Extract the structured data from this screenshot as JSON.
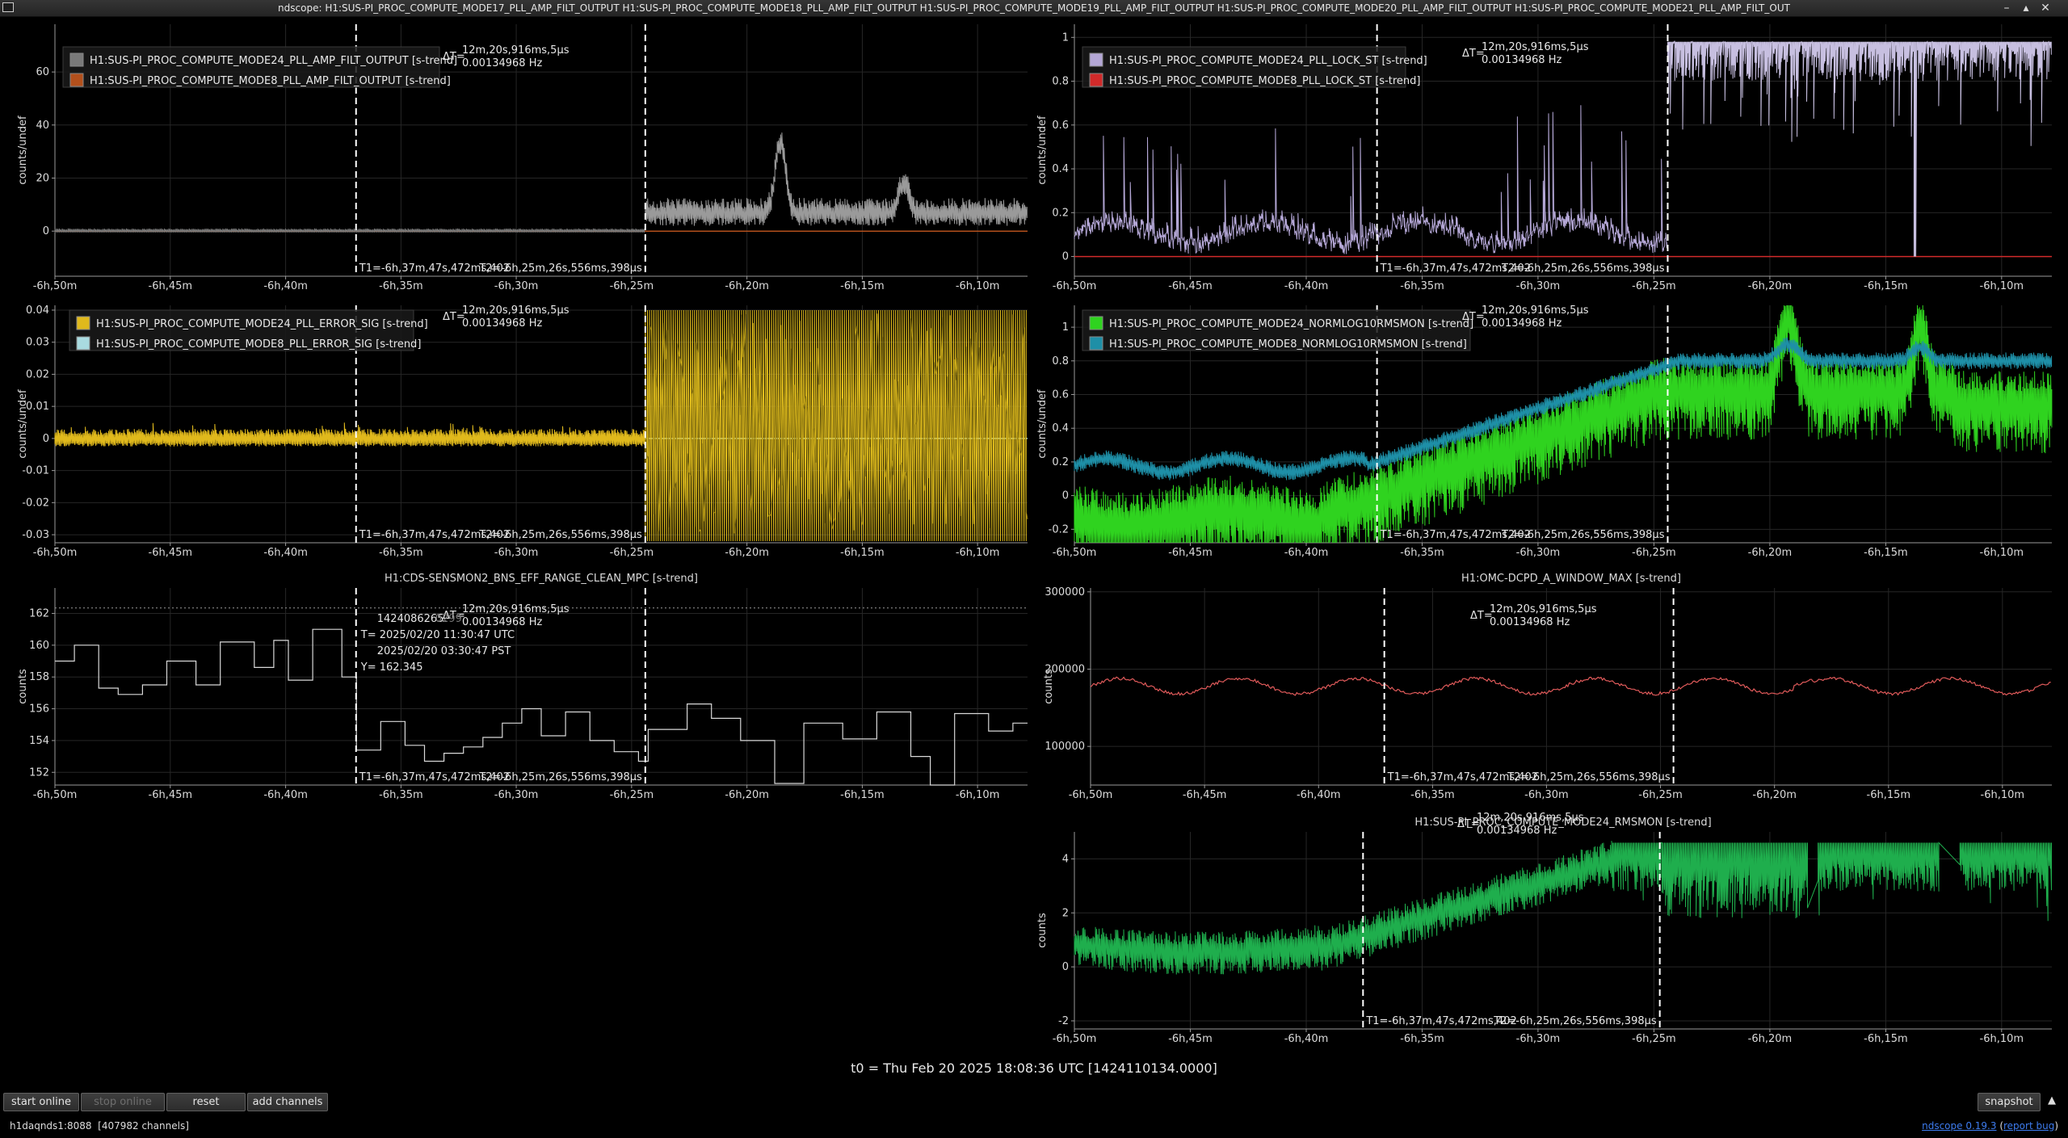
{
  "window": {
    "title": "ndscope: H1:SUS-PI_PROC_COMPUTE_MODE17_PLL_AMP_FILT_OUTPUT H1:SUS-PI_PROC_COMPUTE_MODE18_PLL_AMP_FILT_OUTPUT H1:SUS-PI_PROC_COMPUTE_MODE19_PLL_AMP_FILT_OUTPUT H1:SUS-PI_PROC_COMPUTE_MODE20_PLL_AMP_FILT_OUTPUT H1:SUS-PI_PROC_COMPUTE_MODE21_PLL_AMP_FILT_OUT",
    "minimize_icon": "minimize-icon",
    "maximize_icon": "maximize-icon",
    "close_icon": "close-icon"
  },
  "common": {
    "x_ticks": [
      "-6h,50m",
      "-6h,45m",
      "-6h,40m",
      "-6h,35m",
      "-6h,30m",
      "-6h,25m",
      "-6h,20m",
      "-6h,15m",
      "-6h,10m"
    ],
    "delta_t_label": "ΔT=",
    "delta_t_value": "12m,20s,916ms,5μs",
    "delta_f_value": "0.00134968 Hz",
    "t1_label": "T1=-6h,37m,47s,472ms,402",
    "t2_label": "T2=-6h,25m,26s,556ms,398μs",
    "t0_label": "t0 = Thu Feb 20 2025 18:08:36 UTC [1424110134.0000]"
  },
  "plots": [
    {
      "id": "amp-filt",
      "ylabel": "counts/undef",
      "y_ticks": [
        "0",
        "20",
        "40",
        "60"
      ],
      "ylim": [
        -17,
        78
      ],
      "legend": [
        {
          "name": "H1:SUS-PI_PROC_COMPUTE_MODE24_PLL_AMP_FILT_OUTPUT [s-trend]",
          "color": "#7a7a7a"
        },
        {
          "name": "H1:SUS-PI_PROC_COMPUTE_MODE8_PLL_AMP_FILT_OUTPUT [s-trend]",
          "color": "#b3501c"
        }
      ]
    },
    {
      "id": "lock-st",
      "ylabel": "counts/undef",
      "y_ticks": [
        "0",
        "0.2",
        "0.4",
        "0.6",
        "0.8",
        "1"
      ],
      "ylim": [
        -0.09,
        1.06
      ],
      "legend": [
        {
          "name": "H1:SUS-PI_PROC_COMPUTE_MODE24_PLL_LOCK_ST [s-trend]",
          "color": "#b4a7d6"
        },
        {
          "name": "H1:SUS-PI_PROC_COMPUTE_MODE8_PLL_LOCK_ST [s-trend]",
          "color": "#d12a2a"
        }
      ]
    },
    {
      "id": "error-sig",
      "ylabel": "counts/undef",
      "y_ticks": [
        "-0.03",
        "-0.02",
        "-0.01",
        "0",
        "0.01",
        "0.02",
        "0.03",
        "0.04"
      ],
      "ylim": [
        -0.0325,
        0.0415
      ],
      "legend": [
        {
          "name": "H1:SUS-PI_PROC_COMPUTE_MODE24_PLL_ERROR_SIG [s-trend]",
          "color": "#e0b91c"
        },
        {
          "name": "H1:SUS-PI_PROC_COMPUTE_MODE8_PLL_ERROR_SIG [s-trend]",
          "color": "#a9dbe0"
        }
      ]
    },
    {
      "id": "normlog",
      "ylabel": "counts/undef",
      "y_ticks": [
        "-0.2",
        "0",
        "0.2",
        "0.4",
        "0.6",
        "0.8",
        "1"
      ],
      "ylim": [
        -0.28,
        1.13
      ],
      "legend": [
        {
          "name": "H1:SUS-PI_PROC_COMPUTE_MODE24_NORMLOG10RMSMON [s-trend]",
          "color": "#2fd31f"
        },
        {
          "name": "H1:SUS-PI_PROC_COMPUTE_MODE8_NORMLOG10RMSMON [s-trend]",
          "color": "#1e8fa7"
        }
      ]
    },
    {
      "id": "bns-range",
      "title": "H1:CDS-SENSMON2_BNS_EFF_RANGE_CLEAN_MPC [s-trend]",
      "ylabel": "counts",
      "y_ticks": [
        "152",
        "154",
        "156",
        "158",
        "160",
        "162"
      ],
      "ylim": [
        151.2,
        163.6
      ],
      "series_color": "#d8d8d8",
      "crosshair": {
        "gps": "1424086265.",
        "gps_faded": "0299",
        "utc": "T= 2025/02/20 11:30:47 UTC",
        "pst": "2025/02/20 03:30:47 PST",
        "y": "Y= 162.345"
      }
    },
    {
      "id": "dcpd",
      "title": "H1:OMC-DCPD_A_WINDOW_MAX [s-trend]",
      "ylabel": "counts",
      "y_ticks": [
        "100000",
        "200000",
        "300000"
      ],
      "ylim": [
        50000,
        305000
      ],
      "series_color": "#e05a5a"
    },
    {
      "id": "rmsmon",
      "title": "H1:SUS-PI_PROC_COMPUTE_MODE24_RMSMON [s-trend]",
      "ylabel": "counts",
      "y_ticks": [
        "-2",
        "0",
        "2",
        "4"
      ],
      "ylim": [
        -2.3,
        5.0
      ],
      "series_color": "#1fae4d"
    }
  ],
  "toolbar": {
    "start_online": "start online",
    "stop_online": "stop online",
    "reset": "reset",
    "add_channels": "add channels",
    "snapshot": "snapshot",
    "collapse_icon": "triangle-up-icon"
  },
  "status": {
    "server": "h1daqnds1:8088  [407982 channels]",
    "app_link": "ndscope 0.19.3",
    "report_link": "report bug"
  }
}
